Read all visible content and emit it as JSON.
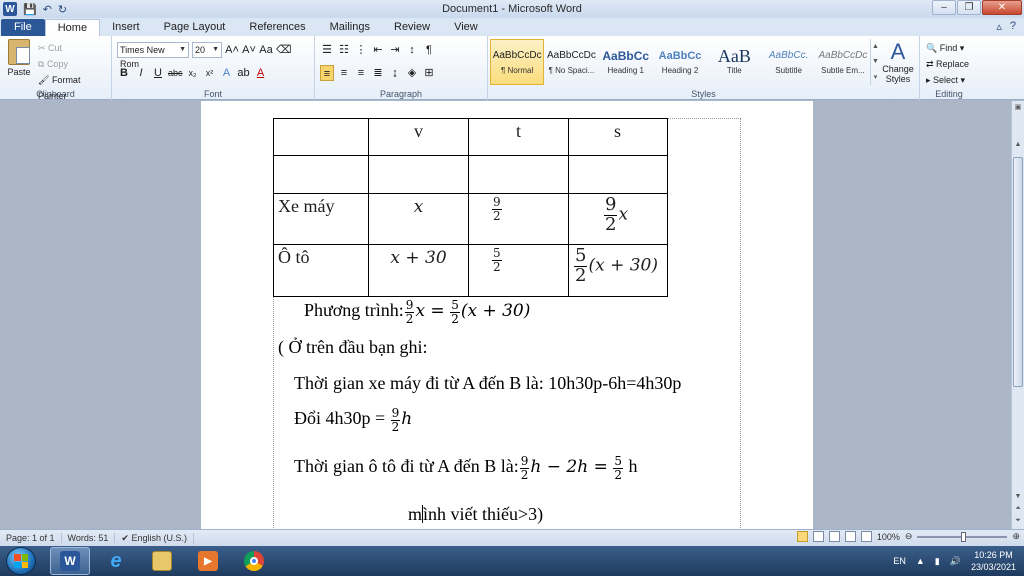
{
  "window": {
    "title": "Document1 - Microsoft Word"
  },
  "qat": {
    "save": "💾",
    "undo": "↶",
    "redo": "↻"
  },
  "tabs": [
    "File",
    "Home",
    "Insert",
    "Page Layout",
    "References",
    "Mailings",
    "Review",
    "View"
  ],
  "clipboard": {
    "paste": "Paste",
    "cut": "Cut",
    "copy": "Copy",
    "format_painter": "Format Painter",
    "label": "Clipboard"
  },
  "font": {
    "name": "Times New Rom",
    "size": "20",
    "label": "Font"
  },
  "paragraph": {
    "label": "Paragraph"
  },
  "styles": {
    "label": "Styles",
    "items": [
      {
        "sample": "AaBbCcDc",
        "name": "¶ Normal"
      },
      {
        "sample": "AaBbCcDc",
        "name": "¶ No Spaci..."
      },
      {
        "sample": "AaBbCc",
        "name": "Heading 1"
      },
      {
        "sample": "AaBbCc",
        "name": "Heading 2"
      },
      {
        "sample": "AaB",
        "name": "Title"
      },
      {
        "sample": "AaBbCc.",
        "name": "Subtitle"
      },
      {
        "sample": "AaBbCcDc",
        "name": "Subtle Em..."
      }
    ],
    "change_styles": "Change Styles"
  },
  "editing": {
    "find": "Find",
    "replace": "Replace",
    "select": "Select",
    "label": "Editing"
  },
  "document": {
    "table": {
      "header": [
        "",
        "v",
        "t",
        "s"
      ],
      "rows": [
        {
          "label": "Xe máy",
          "v": "x",
          "t_num": "9",
          "t_den": "2",
          "s_num": "9",
          "s_den": "2",
          "s_rest": "x"
        },
        {
          "label": "Ô tô",
          "v": "x + 30",
          "t_num": "5",
          "t_den": "2",
          "s_num": "5",
          "s_den": "2",
          "s_rest": "(x + 30)"
        }
      ]
    },
    "eq_label": "Phương trình:",
    "eq_n1": "9",
    "eq_d1": "2",
    "eq_mid": "x =",
    "eq_n2": "5",
    "eq_d2": "2",
    "eq_rest": "(x + 30)",
    "note_open": "( Ở trên đầu bạn ghi:",
    "line1": "Thời gian xe máy đi từ A đến B là: 10h30p-6h=4h30p",
    "line2_prefix": "Đổi 4h30p =",
    "line2_num": "9",
    "line2_den": "2",
    "line2_unit": "h",
    "line3_prefix": "Thời gian ô tô đi từ A đến B là:",
    "line3_n1": "9",
    "line3_d1": "2",
    "line3_mid": "h − 2h =",
    "line3_n2": "5",
    "line3_d2": "2",
    "line3_unit": "h",
    "line4_a": "m",
    "line4_b": "ình viết thiếu>3)"
  },
  "status": {
    "page": "Page: 1 of 1",
    "words": "Words: 51",
    "lang": "English (U.S.)",
    "zoom": "100%"
  },
  "tray": {
    "lang": "EN",
    "time": "10:26 PM",
    "date": "23/03/2021"
  }
}
